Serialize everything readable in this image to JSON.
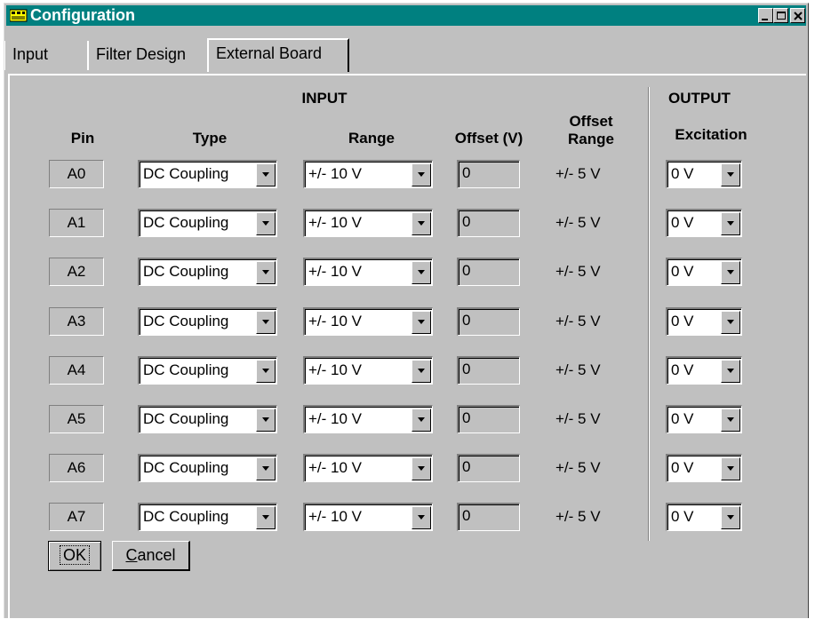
{
  "window": {
    "title": "Configuration",
    "controls": [
      "minimize",
      "maximize",
      "close"
    ]
  },
  "tabs": [
    {
      "label": "Input",
      "active": false
    },
    {
      "label": "Filter Design",
      "active": false
    },
    {
      "label": "External Board",
      "active": true
    }
  ],
  "headers": {
    "input_group": "INPUT",
    "output_group": "OUTPUT",
    "pin": "Pin",
    "type": "Type",
    "range": "Range",
    "offset": "Offset (V)",
    "offset_range_line1": "Offset",
    "offset_range_line2": "Range",
    "excitation": "Excitation"
  },
  "rows": [
    {
      "pin": "A0",
      "type": "DC Coupling",
      "range": "+/- 10 V",
      "offset": "0",
      "offset_range": "+/- 5 V",
      "excitation": "0 V"
    },
    {
      "pin": "A1",
      "type": "DC Coupling",
      "range": "+/- 10 V",
      "offset": "0",
      "offset_range": "+/- 5 V",
      "excitation": "0 V"
    },
    {
      "pin": "A2",
      "type": "DC Coupling",
      "range": "+/- 10 V",
      "offset": "0",
      "offset_range": "+/- 5 V",
      "excitation": "0 V"
    },
    {
      "pin": "A3",
      "type": "DC Coupling",
      "range": "+/- 10 V",
      "offset": "0",
      "offset_range": "+/- 5 V",
      "excitation": "0 V"
    },
    {
      "pin": "A4",
      "type": "DC Coupling",
      "range": "+/- 10 V",
      "offset": "0",
      "offset_range": "+/- 5 V",
      "excitation": "0 V"
    },
    {
      "pin": "A5",
      "type": "DC Coupling",
      "range": "+/- 10 V",
      "offset": "0",
      "offset_range": "+/- 5 V",
      "excitation": "0 V"
    },
    {
      "pin": "A6",
      "type": "DC Coupling",
      "range": "+/- 10 V",
      "offset": "0",
      "offset_range": "+/- 5 V",
      "excitation": "0 V"
    },
    {
      "pin": "A7",
      "type": "DC Coupling",
      "range": "+/- 10 V",
      "offset": "0",
      "offset_range": "+/- 5 V",
      "excitation": "0 V"
    }
  ],
  "buttons": {
    "ok": "OK",
    "cancel_first": "C",
    "cancel_rest": "ancel"
  },
  "colors": {
    "titlebar": "#008080",
    "face": "#c0c0c0"
  },
  "icons": {
    "app": "app-window-icon",
    "minimize": "minimize-icon",
    "maximize": "maximize-icon",
    "close": "close-icon",
    "dropdown": "chevron-down-icon"
  }
}
